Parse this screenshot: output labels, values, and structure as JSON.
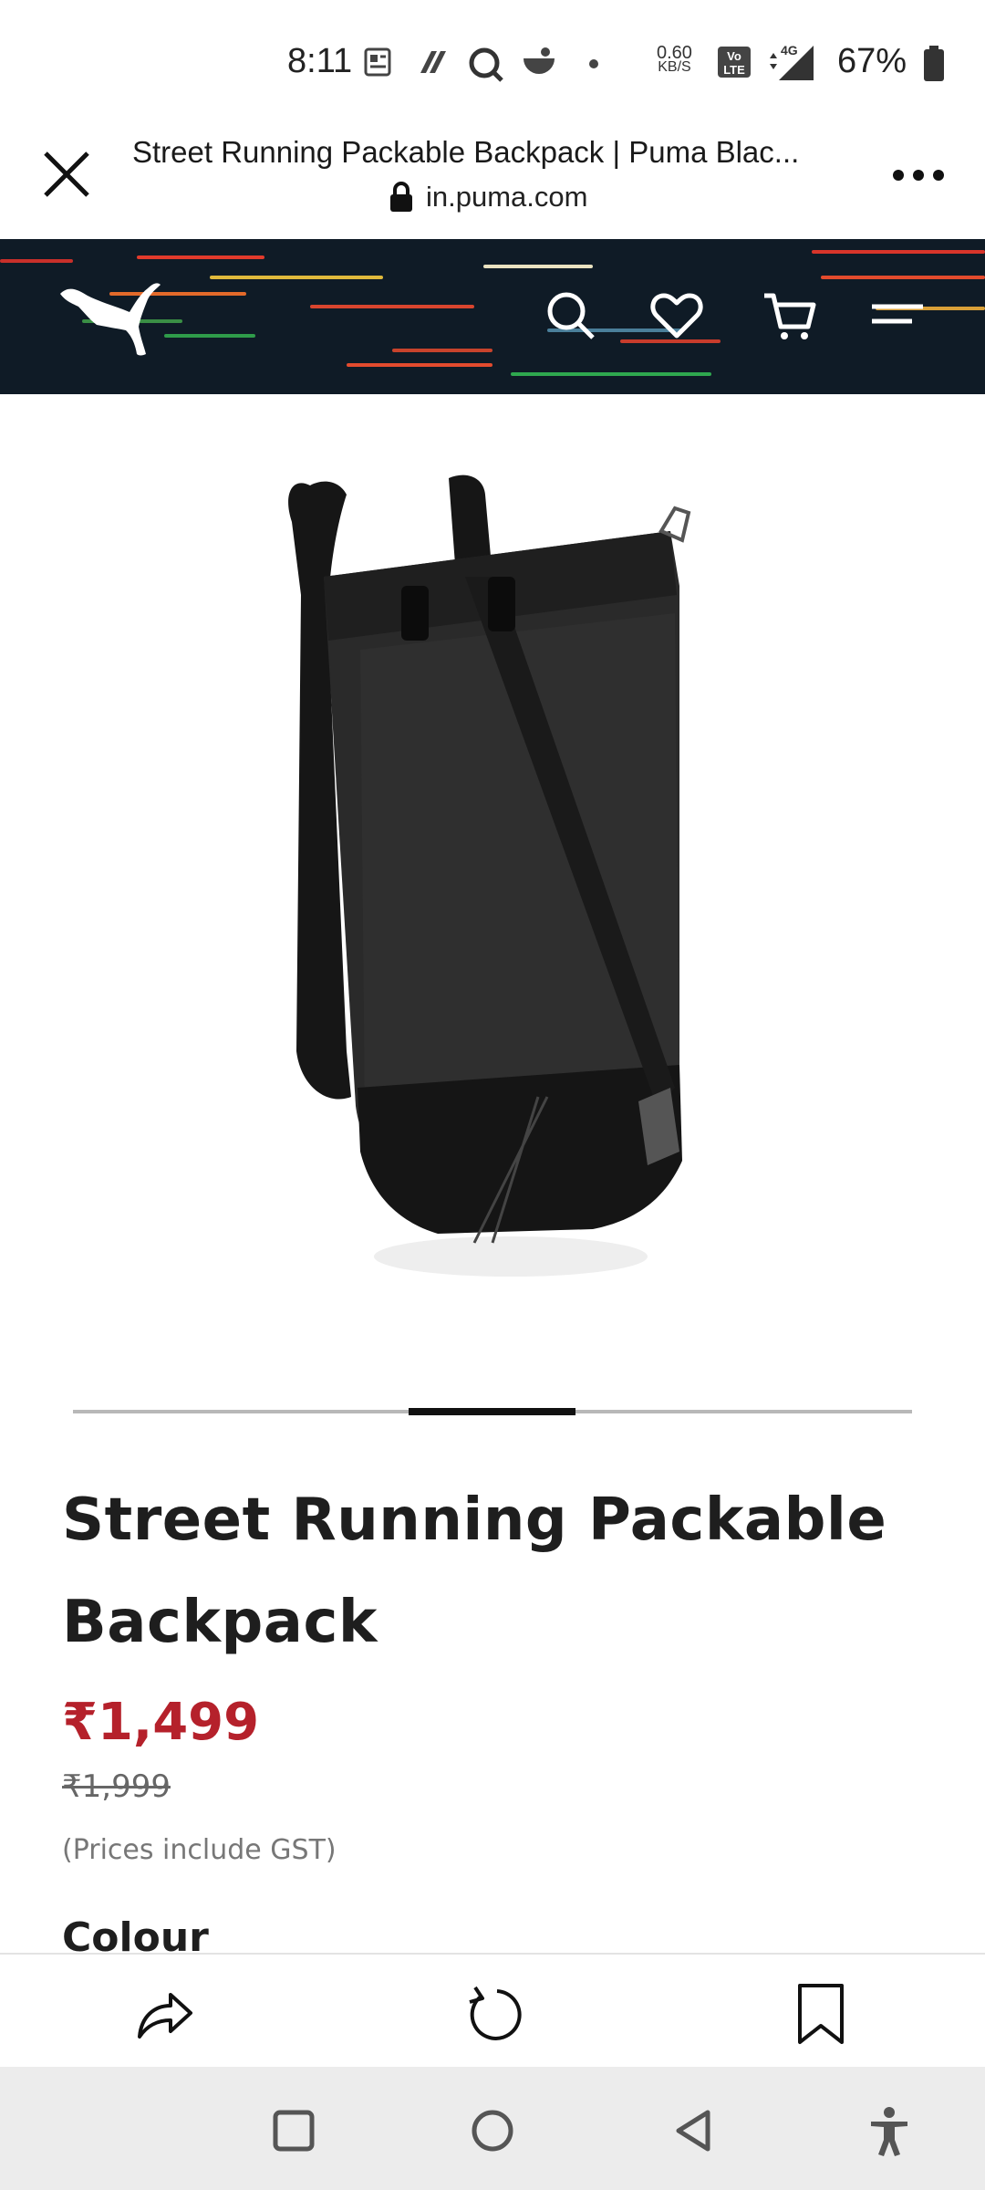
{
  "status_bar": {
    "time": "8:11",
    "net_speed_value": "0.60",
    "net_speed_unit": "KB/S",
    "network_label": "4G",
    "volte_label": "Vo LTE",
    "battery_percent": "67%",
    "icons": [
      "news-icon",
      "app-icon",
      "search-app-icon",
      "food-app-icon",
      "dot-icon",
      "volte-icon",
      "signal-icon",
      "battery-icon"
    ]
  },
  "browser": {
    "page_title": "Street Running Packable Backpack | Puma Blac...",
    "url": "in.puma.com"
  },
  "site_nav": {
    "icons": [
      "puma-logo-icon",
      "search-icon",
      "heart-icon",
      "cart-icon",
      "menu-icon"
    ]
  },
  "product": {
    "title": "Street Running Packable Backpack",
    "price": "₹1,499",
    "original_price": "₹1,999",
    "tax_note": "(Prices include GST)",
    "colour_label": "Colour",
    "image_description_icon": "backpack-image",
    "carousel": {
      "active_index": 2,
      "total": 5
    }
  },
  "bottom_toolbar": {
    "icons": [
      "share-icon",
      "refresh-icon",
      "bookmark-icon"
    ]
  },
  "system_nav": {
    "icons": [
      "recents-icon",
      "home-icon",
      "back-icon",
      "accessibility-icon"
    ]
  },
  "colors": {
    "price_red": "#b5212b",
    "nav_bg": "#0f1b26",
    "system_nav_bg": "#ececec"
  }
}
